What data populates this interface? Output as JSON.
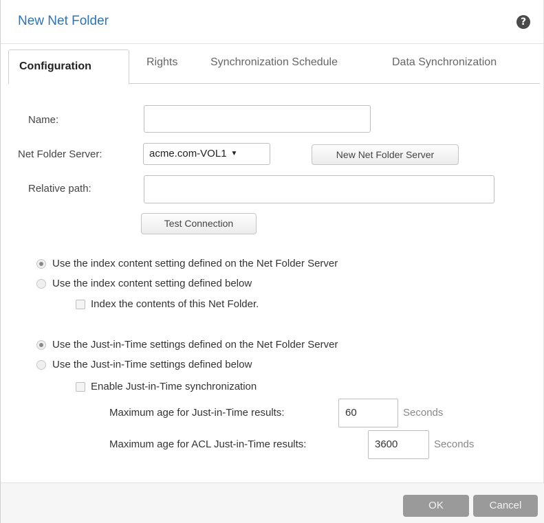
{
  "dialog": {
    "title": "New Net Folder",
    "help_icon": "question-circle-icon",
    "help_glyph": "?"
  },
  "tabs": [
    {
      "label": "Configuration",
      "active": true
    },
    {
      "label": "Rights",
      "active": false
    },
    {
      "label": "Synchronization Schedule",
      "active": false
    },
    {
      "label": "Data Synchronization",
      "active": false
    }
  ],
  "form": {
    "name_label": "Name:",
    "name_value": "",
    "server_label": "Net Folder Server:",
    "server_value": "acme.com-VOL1",
    "server_caret": "▼",
    "new_server_button": "New Net Folder Server",
    "relative_path_label": "Relative path:",
    "relative_path_value": "",
    "test_connection_button": "Test Connection"
  },
  "index": {
    "option_server": "Use the index content setting defined on the Net Folder Server",
    "option_below": "Use the index content setting defined below",
    "selected": "server",
    "checkbox_label": "Index the contents of this Net Folder.",
    "checkbox_checked": false
  },
  "jit": {
    "option_server": "Use the Just-in-Time settings defined on the Net Folder Server",
    "option_below": "Use the Just-in-Time settings defined below",
    "selected": "server",
    "checkbox_label": "Enable Just-in-Time synchronization",
    "checkbox_checked": false,
    "max_age_label": "Maximum age for Just-in-Time results:",
    "max_age_value": "60",
    "max_age_unit": "Seconds",
    "acl_max_age_label": "Maximum age for ACL Just-in-Time results:",
    "acl_max_age_value": "3600",
    "acl_max_age_unit": "Seconds"
  },
  "footer": {
    "ok_button": "OK",
    "cancel_button": "Cancel"
  }
}
